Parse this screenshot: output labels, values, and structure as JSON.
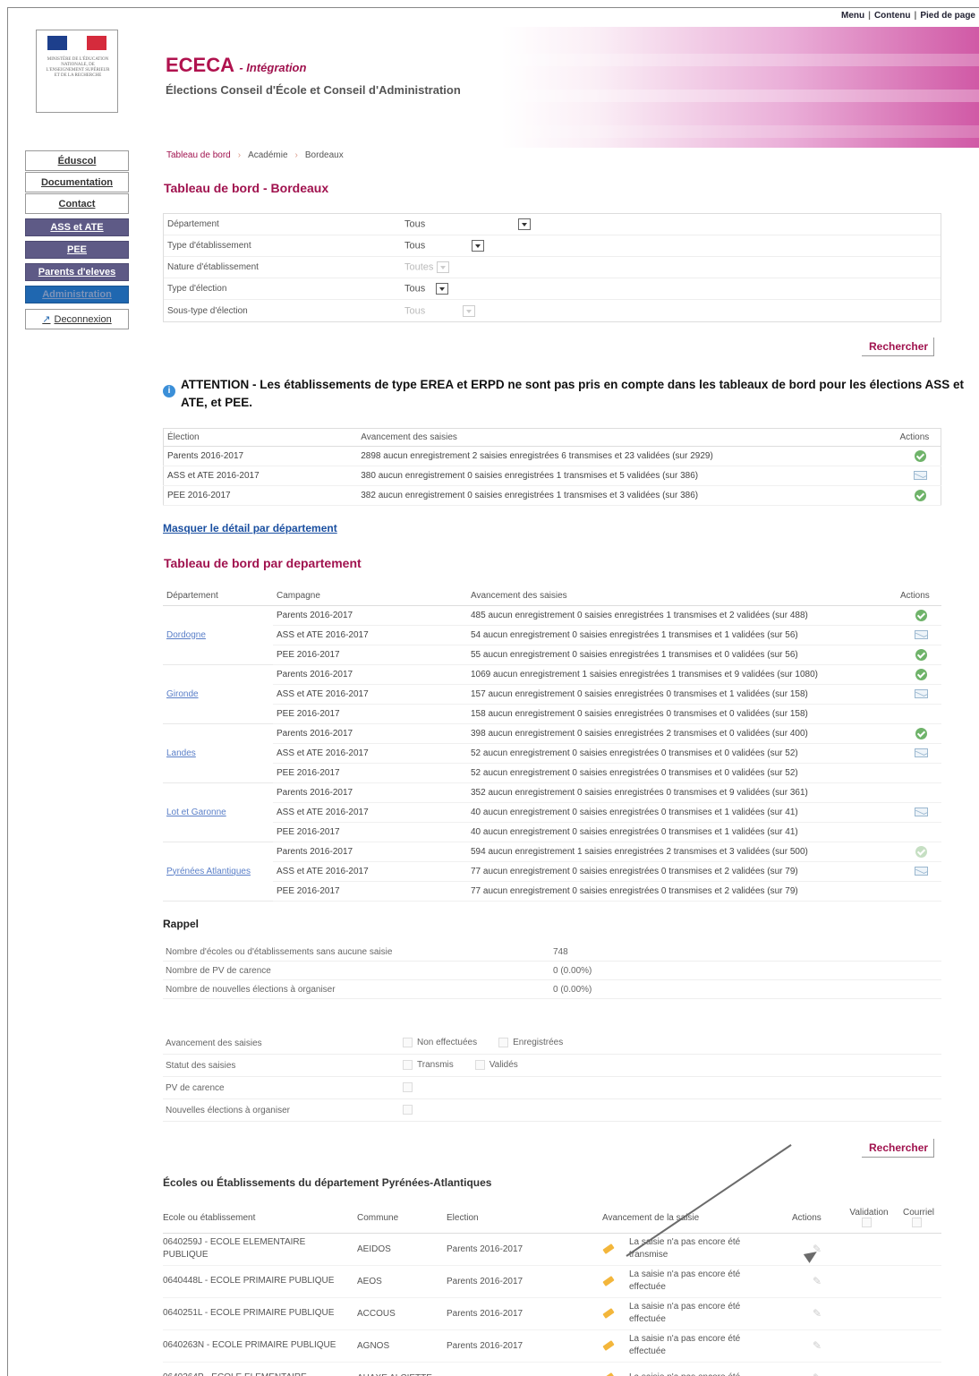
{
  "toplinks": [
    "Menu",
    "Contenu",
    "Pied de page"
  ],
  "brand": {
    "name": "ECECA",
    "suffix": "- Intégration",
    "subtitle": "Élections Conseil d'École et Conseil d'Administration"
  },
  "sidebar": [
    {
      "label": "Éduscol",
      "style": "plain"
    },
    {
      "label": "Documentation",
      "style": "plain"
    },
    {
      "label": "Contact",
      "style": "plain"
    },
    {
      "label": "ASS et ATE",
      "style": "dark"
    },
    {
      "label": "PEE",
      "style": "dark"
    },
    {
      "label": "Parents d'eleves",
      "style": "dark"
    },
    {
      "label": "Administration",
      "style": "blue"
    },
    {
      "label": "Deconnexion",
      "style": "logout"
    }
  ],
  "breadcrumb": [
    "Tableau de bord",
    "Académie",
    "Bordeaux"
  ],
  "page_title": "Tableau de bord - Bordeaux",
  "filters": [
    {
      "label": "Département",
      "value": "Tous",
      "enabled": true
    },
    {
      "label": "Type d'établissement",
      "value": "Tous",
      "enabled": true
    },
    {
      "label": "Nature d'établissement",
      "value": "Toutes",
      "enabled": false
    },
    {
      "label": "Type d'élection",
      "value": "Tous",
      "enabled": true
    },
    {
      "label": "Sous-type d'élection",
      "value": "Tous",
      "enabled": false
    }
  ],
  "search_label": "Rechercher",
  "attention": "ATTENTION - Les établissements de type EREA et ERPD ne sont pas pris en compte dans les tableaux de bord pour les élections ASS et ATE, et PEE.",
  "summary": {
    "headers": [
      "Élection",
      "Avancement des saisies",
      "Actions"
    ],
    "rows": [
      {
        "election": "Parents 2016-2017",
        "progress": "2898 aucun enregistrement 2 saisies enregistrées 6 transmises et 23 validées (sur 2929)",
        "action": "check"
      },
      {
        "election": "ASS et ATE 2016-2017",
        "progress": "380 aucun enregistrement 0 saisies enregistrées 1 transmises et 5 validées (sur 386)",
        "action": "mail"
      },
      {
        "election": "PEE 2016-2017",
        "progress": "382 aucun enregistrement 0 saisies enregistrées 1 transmises et 3 validées (sur 386)",
        "action": "check"
      }
    ]
  },
  "toggle_link": "Masquer le détail par département",
  "dept_title": "Tableau de bord par departement",
  "dept_table": {
    "headers": [
      "Département",
      "Campagne",
      "Avancement des saisies",
      "Actions"
    ],
    "groups": [
      {
        "dept": "Dordogne",
        "rows": [
          {
            "campaign": "Parents 2016-2017",
            "progress": "485 aucun enregistrement 0 saisies enregistrées 1 transmises et 2 validées (sur 488)",
            "action": "check"
          },
          {
            "campaign": "ASS et ATE 2016-2017",
            "progress": "54 aucun enregistrement 0 saisies enregistrées 1 transmises et 1 validées (sur 56)",
            "action": "mail"
          },
          {
            "campaign": "PEE 2016-2017",
            "progress": "55 aucun enregistrement 0 saisies enregistrées 1 transmises et 0 validées (sur 56)",
            "action": "check"
          }
        ]
      },
      {
        "dept": "Gironde",
        "rows": [
          {
            "campaign": "Parents 2016-2017",
            "progress": "1069 aucun enregistrement 1 saisies enregistrées 1 transmises et 9 validées (sur 1080)",
            "action": "check"
          },
          {
            "campaign": "ASS et ATE 2016-2017",
            "progress": "157 aucun enregistrement 0 saisies enregistrées 0 transmises et 1 validées (sur 158)",
            "action": "mail"
          },
          {
            "campaign": "PEE 2016-2017",
            "progress": "158 aucun enregistrement 0 saisies enregistrées 0 transmises et 0 validées (sur 158)",
            "action": ""
          }
        ]
      },
      {
        "dept": "Landes",
        "rows": [
          {
            "campaign": "Parents 2016-2017",
            "progress": "398 aucun enregistrement 0 saisies enregistrées 2 transmises et 0 validées (sur 400)",
            "action": "check"
          },
          {
            "campaign": "ASS et ATE 2016-2017",
            "progress": "52 aucun enregistrement 0 saisies enregistrées 0 transmises et 0 validées (sur 52)",
            "action": "mail"
          },
          {
            "campaign": "PEE 2016-2017",
            "progress": "52 aucun enregistrement 0 saisies enregistrées 0 transmises et 0 validées (sur 52)",
            "action": ""
          }
        ]
      },
      {
        "dept": "Lot et Garonne",
        "rows": [
          {
            "campaign": "Parents 2016-2017",
            "progress": "352 aucun enregistrement 0 saisies enregistrées 0 transmises et 9 validées (sur 361)",
            "action": ""
          },
          {
            "campaign": "ASS et ATE 2016-2017",
            "progress": "40 aucun enregistrement 0 saisies enregistrées 0 transmises et 1 validées (sur 41)",
            "action": "mail"
          },
          {
            "campaign": "PEE 2016-2017",
            "progress": "40 aucun enregistrement 0 saisies enregistrées 0 transmises et 1 validées (sur 41)",
            "action": ""
          }
        ]
      },
      {
        "dept": "Pyrénées Atlantiques",
        "rows": [
          {
            "campaign": "Parents 2016-2017",
            "progress": "594 aucun enregistrement 1 saisies enregistrées 2 transmises et 3 validées (sur 500)",
            "action": "check-faint"
          },
          {
            "campaign": "ASS et ATE 2016-2017",
            "progress": "77 aucun enregistrement 0 saisies enregistrées 0 transmises et 2 validées (sur 79)",
            "action": "mail"
          },
          {
            "campaign": "PEE 2016-2017",
            "progress": "77 aucun enregistrement 0 saisies enregistrées 0 transmises et 2 validées (sur 79)",
            "action": ""
          }
        ]
      }
    ]
  },
  "rappel": {
    "title": "Rappel",
    "rows": [
      {
        "label": "Nombre d'écoles ou d'établissements sans aucune saisie",
        "value": "748"
      },
      {
        "label": "Nombre de PV de carence",
        "value": "0 (0.00%)"
      },
      {
        "label": "Nombre de nouvelles élections à organiser",
        "value": "0 (0.00%)"
      }
    ]
  },
  "status_filters": [
    {
      "label": "Avancement des saisies",
      "options": [
        "Non effectuées",
        "Enregistrées"
      ]
    },
    {
      "label": "Statut des saisies",
      "options": [
        "Transmis",
        "Validés"
      ]
    },
    {
      "label": "PV de carence",
      "options": [
        ""
      ]
    },
    {
      "label": "Nouvelles élections à organiser",
      "options": [
        ""
      ]
    }
  ],
  "schools": {
    "title_prefix": "Écoles ou Établissements du département",
    "title_dept": "Pyrénées-Atlantiques",
    "headers": [
      "Ecole ou établissement",
      "Commune",
      "Election",
      "Avancement de la saisie",
      "Actions",
      "Validation",
      "Courriel"
    ],
    "rows": [
      {
        "name": "0640259J - ECOLE ELEMENTAIRE PUBLIQUE",
        "commune": "AEIDOS",
        "election": "Parents 2016-2017",
        "status": "La saisie n'a pas encore été transmise"
      },
      {
        "name": "0640448L - ECOLE PRIMAIRE PUBLIQUE",
        "commune": "AEOS",
        "election": "Parents 2016-2017",
        "status": "La saisie n'a pas encore été effectuée"
      },
      {
        "name": "0640251L - ECOLE PRIMAIRE PUBLIQUE",
        "commune": "ACCOUS",
        "election": "Parents 2016-2017",
        "status": "La saisie n'a pas encore été effectuée"
      },
      {
        "name": "0640263N - ECOLE PRIMAIRE PUBLIQUE",
        "commune": "AGNOS",
        "election": "Parents 2016-2017",
        "status": "La saisie n'a pas encore été effectuée"
      },
      {
        "name": "0640264P - ECOLE ELEMENTAIRE",
        "commune": "AHAXE ALCIETTE",
        "election": "",
        "status": "La saisie n'a pas encore été"
      }
    ]
  }
}
